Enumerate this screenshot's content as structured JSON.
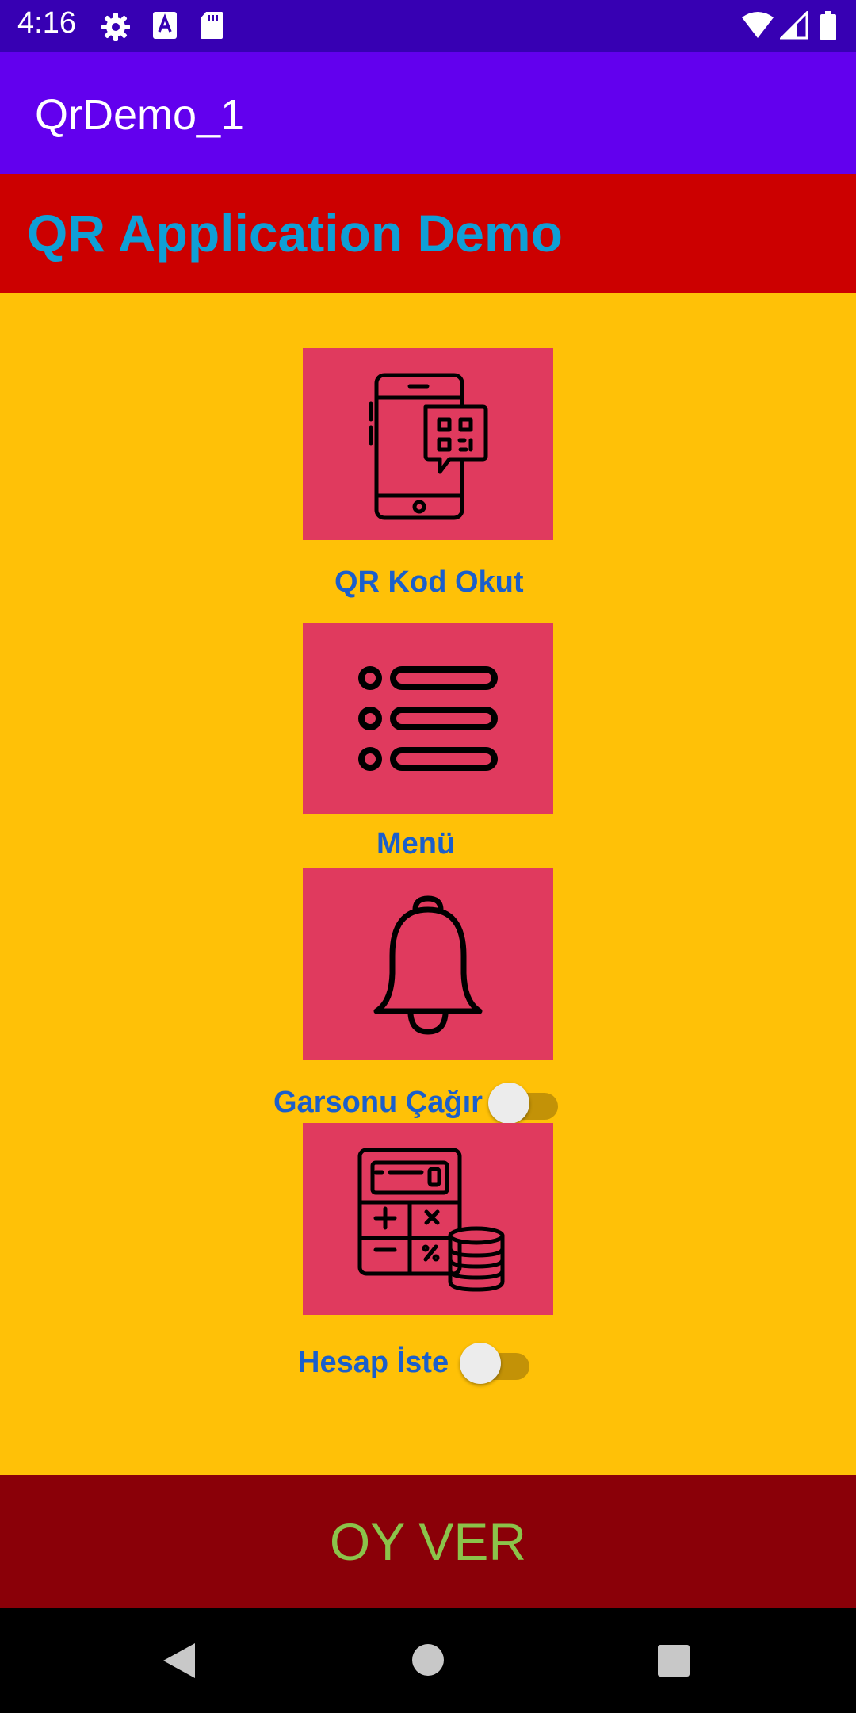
{
  "status_bar": {
    "time": "4:16",
    "left_icons": [
      "gear-icon",
      "font-a-icon",
      "sd-card-icon"
    ],
    "right_icons": [
      "wifi-icon",
      "signal-icon",
      "battery-icon"
    ]
  },
  "app_bar": {
    "title": "QrDemo_1"
  },
  "header": {
    "title": "QR Application Demo"
  },
  "tiles": [
    {
      "icon": "phone-qr-icon",
      "label": "QR Kod Okut"
    },
    {
      "icon": "list-icon",
      "label": "Menü"
    },
    {
      "icon": "bell-icon",
      "label": "Garsonu Çağır",
      "switch_on": false
    },
    {
      "icon": "calculator-coins-icon",
      "label": "Hesap İste",
      "switch_on": false
    }
  ],
  "footer": {
    "button_label": "OY VER"
  },
  "nav_bar": {
    "icons": [
      "back-icon",
      "home-icon",
      "recents-icon"
    ]
  },
  "colors": {
    "status_bar": "#3700b3",
    "app_bar": "#6200ee",
    "header_band": "#cc0000",
    "header_text": "#0f9fd6",
    "content_bg": "#ffc107",
    "tile_bg": "#e03a5e",
    "label_text": "#1a5fcc",
    "footer_button": "#8a0008",
    "footer_text": "#8bc34a"
  }
}
